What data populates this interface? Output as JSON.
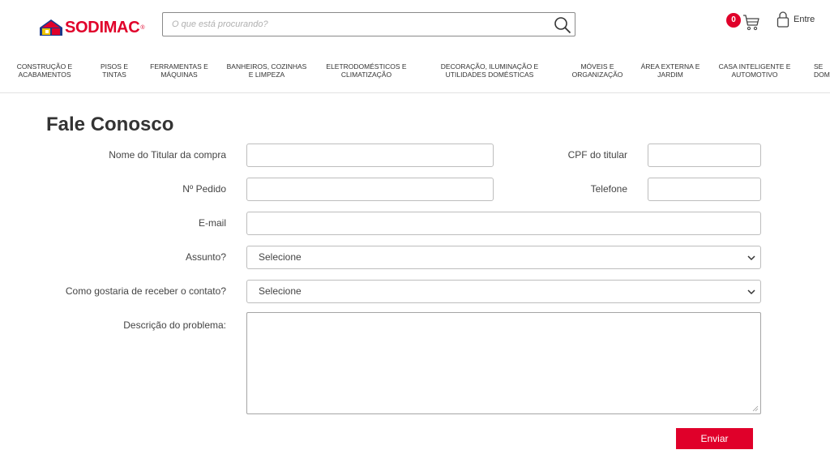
{
  "header": {
    "logo_text": "SODIMAC",
    "logo_reg": "®",
    "search_placeholder": "O que está procurando?",
    "cart_count": "0",
    "login_label": "Entre",
    "brand_color": "#e0002a"
  },
  "nav": {
    "items": [
      {
        "label": "Construção e\nacabamentos"
      },
      {
        "label": "Pisos e\ntintas"
      },
      {
        "label": "Ferramentas e\nmáquinas"
      },
      {
        "label": "Banheiros, cozinhas\ne limpeza"
      },
      {
        "label": "Eletrodomésticos e\nclimatização"
      },
      {
        "label": "Decoração, iluminação e\nutilidades domésticas"
      },
      {
        "label": "Móveis e\norganização"
      },
      {
        "label": "Área externa e\njardim"
      },
      {
        "label": "Casa inteligente e\nautomotivo"
      },
      {
        "label": "Se\ndom"
      }
    ]
  },
  "form": {
    "title": "Fale Conosco",
    "name_label": "Nome do Titular da compra",
    "cpf_label": "CPF do titular",
    "order_label": "Nº Pedido",
    "phone_label": "Telefone",
    "email_label": "E-mail",
    "subject_label": "Assunto?",
    "subject_value": "Selecione",
    "contact_label": "Como gostaria de receber o contato?",
    "contact_value": "Selecione",
    "description_label": "Descrição do problema:",
    "submit_label": "Enviar"
  },
  "icons": {
    "search": "search-icon",
    "cart": "cart-icon",
    "user": "user-icon",
    "chevron": "chevron-down-icon"
  }
}
